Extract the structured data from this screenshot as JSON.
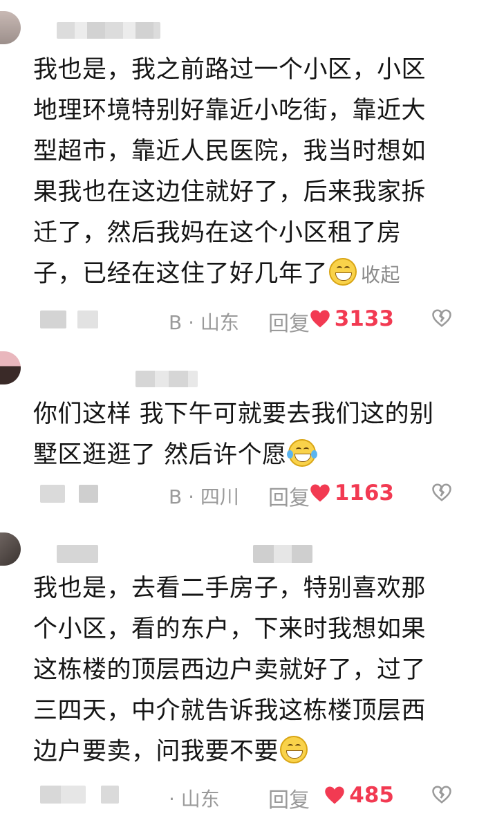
{
  "comments": [
    {
      "text": "我也是，我之前路过一个小区，小区地理环境特别好靠近小吃街，靠近大型超市，靠近人民医院，我当时想如果我也在这边住就好了，后来我家拆迁了，然后我妈在这个小区租了房子，已经在这住了好几年了",
      "lines": [
        "我也是，我之前路过一个小区，小区",
        "地理环境特别好靠近小吃街，靠近大",
        "型超市，靠近人民医院，我当时想如",
        "果我也在这边住就好了，后来我家拆",
        "迁了，然后我妈在这个小区租了房",
        "子，已经在这住了好几年了"
      ],
      "emoji": "grinning-emoji",
      "collapse_label": "收起",
      "location": "B · 山东",
      "reply_label": "回复",
      "likes": "3133"
    },
    {
      "text": "你们这样 我下午可就要去我们这的别墅区逛逛了 然后许个愿",
      "lines": [
        "你们这样 我下午可就要去我们这的别",
        "墅区逛逛了 然后许个愿"
      ],
      "emoji": "tears-of-joy-emoji",
      "location": "B · 四川",
      "reply_label": "回复",
      "likes": "1163"
    },
    {
      "text": "我也是，去看二手房子，特别喜欢那个小区，看的东户，下来时我想如果这栋楼的顶层西边户卖就好了，过了三四天，中介就告诉我这栋楼顶层西边户要卖，问我要不要",
      "lines": [
        "我也是，去看二手房子，特别喜欢那",
        "个小区，看的东户，下来时我想如果",
        "这栋楼的顶层西边户卖就好了，过了",
        "三四天，中介就告诉我这栋楼顶层西",
        "边户要卖，问我要不要"
      ],
      "emoji": "grinning-emoji",
      "location": "· 山东",
      "reply_label": "回复",
      "likes": "485"
    }
  ],
  "colors": {
    "like": "#f23a52",
    "meta": "#9a9a9a",
    "text": "#151515"
  }
}
